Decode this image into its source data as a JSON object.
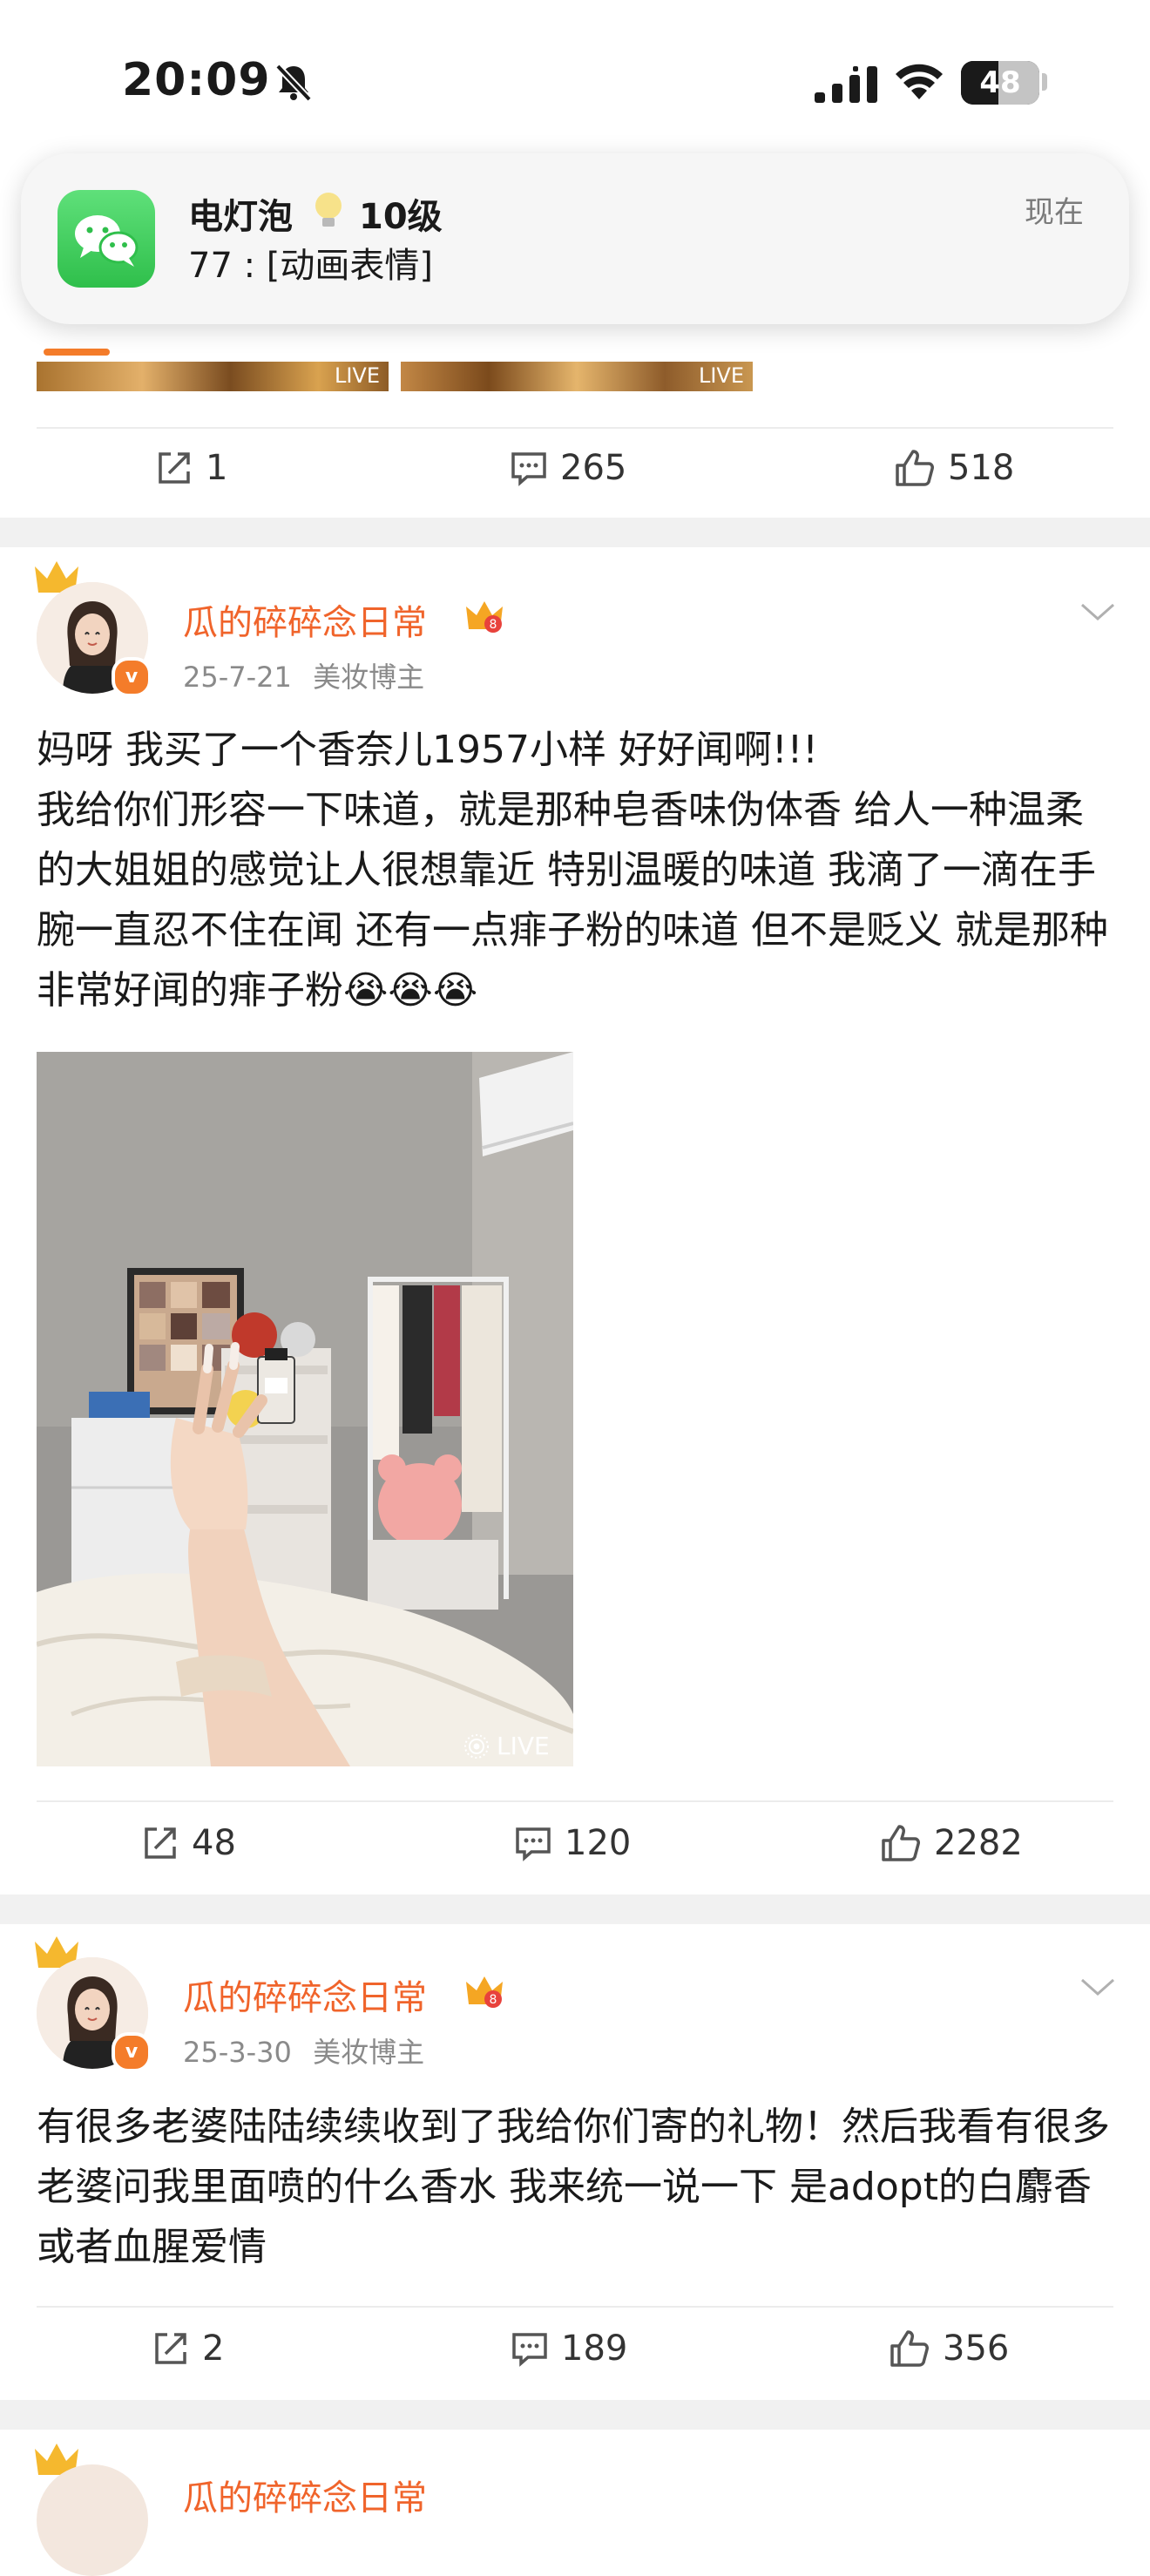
{
  "status_bar": {
    "time": "20:09",
    "battery": "48",
    "battery_level": 0.48
  },
  "notification": {
    "app": "WeChat",
    "title": "电灯泡",
    "level": "10级",
    "body": "77 : [动画表情]",
    "time": "现在"
  },
  "top_post": {
    "image_live": "LIVE",
    "forward_count": "1",
    "comment_count": "265",
    "like_count": "518"
  },
  "posts": [
    {
      "username": "瓜的碎碎念日常",
      "date": "25-7-21",
      "tag": "美妆博主",
      "text": "妈呀 我买了一个香奈儿1957小样 好好闻啊!!!\n我给你们形容一下味道，就是那种皂香味伪体香 给人一种温柔的大姐姐的感觉让人很想靠近 特别温暖的味道 我滴了一滴在手腕一直忍不住在闻 还有一点痱子粉的味道 但不是贬义 就是那种非常好闻的痱子粉",
      "emoji": "😭😭😭",
      "image_live": "LIVE",
      "forward_count": "48",
      "comment_count": "120",
      "like_count": "2282"
    },
    {
      "username": "瓜的碎碎念日常",
      "date": "25-3-30",
      "tag": "美妆博主",
      "text": "有很多老婆陆陆续续收到了我给你们寄的礼物！然后我看有很多老婆问我里面喷的什么香水 我来统一说一下 是adopt的白麝香或者血腥爱情",
      "forward_count": "2",
      "comment_count": "189",
      "like_count": "356"
    },
    {
      "username": "瓜的碎碎念日常"
    }
  ],
  "colors": {
    "username": "#f0642b",
    "accent": "#f47c2a",
    "meta": "#8a8a8a",
    "band": "#f1f1f1"
  }
}
